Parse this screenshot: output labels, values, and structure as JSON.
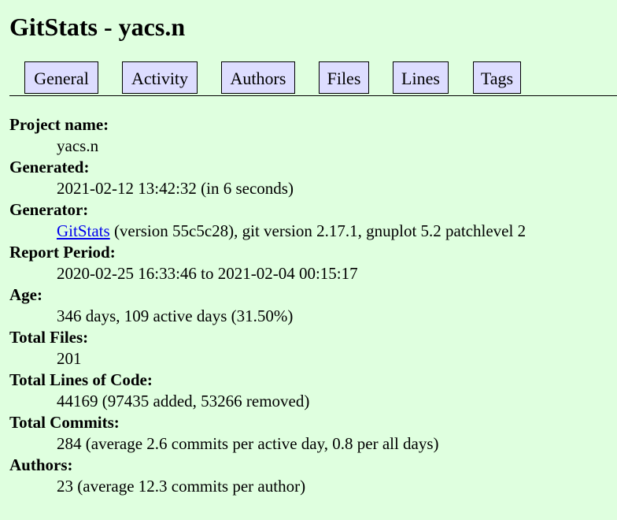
{
  "page": {
    "title": "GitStats - yacs.n"
  },
  "nav": {
    "items": [
      "General",
      "Activity",
      "Authors",
      "Files",
      "Lines",
      "Tags"
    ]
  },
  "general": {
    "project_name_label": "Project name:",
    "project_name": "yacs.n",
    "generated_label": "Generated:",
    "generated": "2021-02-12 13:42:32 (in 6 seconds)",
    "generator_label": "Generator:",
    "generator_link": "GitStats",
    "generator_rest": " (version 55c5c28), git version 2.17.1, gnuplot 5.2 patchlevel 2",
    "report_period_label": "Report Period:",
    "report_period": "2020-02-25 16:33:46 to 2021-02-04 00:15:17",
    "age_label": "Age:",
    "age": "346 days, 109 active days (31.50%)",
    "total_files_label": "Total Files:",
    "total_files": "201",
    "total_loc_label": "Total Lines of Code:",
    "total_loc": "44169 (97435 added, 53266 removed)",
    "total_commits_label": "Total Commits:",
    "total_commits": "284 (average 2.6 commits per active day, 0.8 per all days)",
    "authors_label": "Authors:",
    "authors": "23 (average 12.3 commits per author)"
  }
}
